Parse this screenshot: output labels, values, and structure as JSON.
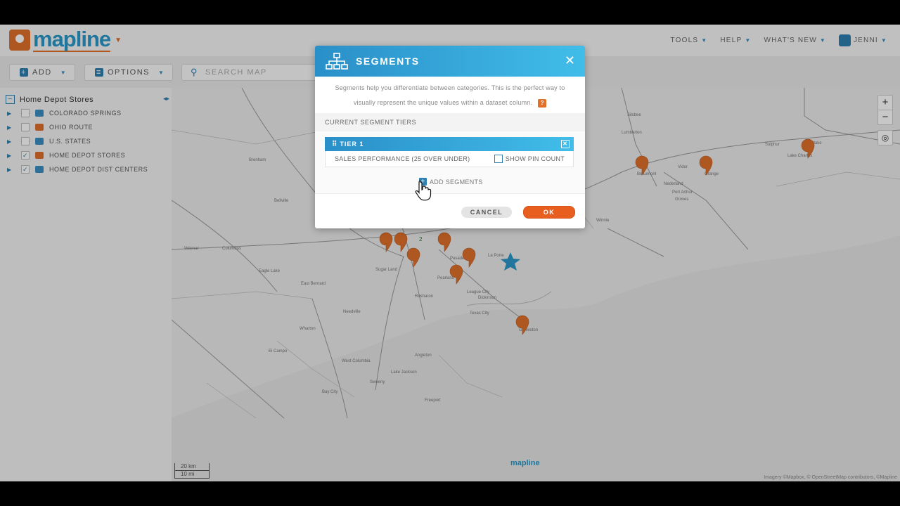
{
  "header": {
    "logo_text": "mapline",
    "nav": [
      {
        "label": "TOOLS"
      },
      {
        "label": "HELP"
      },
      {
        "label": "WHAT'S NEW"
      },
      {
        "label": "JENNI"
      }
    ]
  },
  "toolbar": {
    "add_label": "ADD",
    "options_label": "OPTIONS",
    "search_placeholder": "SEARCH MAP"
  },
  "sidebar": {
    "root_label": "Home Depot Stores",
    "items": [
      {
        "label": "COLORADO SPRINGS",
        "checked": false,
        "icon": "car-icon",
        "color": "#3a8fc0"
      },
      {
        "label": "OHIO ROUTE",
        "checked": false,
        "icon": "car-icon",
        "color": "#e0702a"
      },
      {
        "label": "U.S. STATES",
        "checked": false,
        "icon": "territory-icon",
        "color": "#3a8fc0"
      },
      {
        "label": "HOME DEPOT STORES",
        "checked": true,
        "icon": "pin-icon",
        "color": "#e0702a"
      },
      {
        "label": "HOME DEPOT DIST CENTERS",
        "checked": true,
        "icon": "star-icon",
        "color": "#3a8fc0"
      }
    ]
  },
  "map": {
    "zoom_in": "+",
    "zoom_out": "−",
    "scale_km": "20 km",
    "scale_mi": "10 mi",
    "watermark": "mapline",
    "attribution": "Imagery ©Mapbox, © OpenStreetMap contributors, ©Mapline",
    "cluster_count": "2",
    "city_labels": [
      "Silsbee",
      "Lumberton",
      "Beaumont",
      "Vidor",
      "Orange",
      "Sulphur",
      "Lake Charles",
      "Westlake",
      "Brenham",
      "Bellville",
      "Weimar",
      "Columbus",
      "Eagle Lake",
      "East Bernard",
      "Sugar Land",
      "Pasadena",
      "La Porte",
      "Pearland",
      "League City",
      "Dickinson",
      "Texas City",
      "Galveston",
      "Rosharon",
      "Angleton",
      "West Columbia",
      "Bay City",
      "Lake Jackson",
      "Freeport",
      "Wharton",
      "El Campo",
      "Needville",
      "Sweeny",
      "Nederland",
      "Port Arthur",
      "Groves",
      "Winnie"
    ],
    "accent_orange": "#e0702a",
    "accent_blue": "#2a98c8"
  },
  "dialog": {
    "title": "SEGMENTS",
    "description_line1": "Segments help you differentiate between categories. This is the perfect way to",
    "description_line2": "visually represent the unique values within a dataset column.",
    "help_badge": "?",
    "section_label": "CURRENT SEGMENT TIERS",
    "tier": {
      "label": "TIER 1",
      "value": "SALES PERFORMANCE (25 OVER UNDER)",
      "show_pin_count_label": "SHOW PIN COUNT",
      "show_pin_count_checked": false
    },
    "add_segments_label": "ADD SEGMENTS",
    "cancel_label": "CANCEL",
    "ok_label": "OK"
  }
}
